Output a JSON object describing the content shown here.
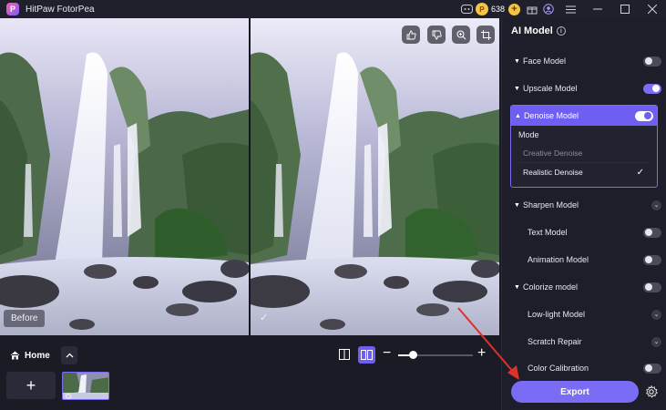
{
  "window": {
    "app_title": "HitPaw FotorPea",
    "logo_letter": "P",
    "credits": "638"
  },
  "canvas": {
    "before_label": "Before",
    "after_check": "✓"
  },
  "bottom": {
    "home_label": "Home",
    "add_symbol": "+",
    "zoom_level": 0.2
  },
  "panel": {
    "title": "AI Model",
    "info_glyph": "i",
    "models": [
      {
        "label": "Face Model",
        "state": "off"
      },
      {
        "label": "Upscale Model",
        "state": "on"
      },
      {
        "label": "Denoise Model",
        "state": "on"
      },
      {
        "label": "Sharpen Model",
        "state": "collapsed"
      },
      {
        "label": "Text Model",
        "state": "off"
      },
      {
        "label": "Animation Model",
        "state": "off"
      },
      {
        "label": "Colorize model",
        "state": "off"
      },
      {
        "label": "Low-light Model",
        "state": "collapsed"
      },
      {
        "label": "Scratch Repair",
        "state": "collapsed"
      },
      {
        "label": "Color Calibration",
        "state": "off"
      }
    ],
    "denoise": {
      "mode_label": "Mode",
      "options": [
        "Creative Denoise",
        "Realistic Denoise"
      ],
      "selected": "Realistic Denoise"
    },
    "export_label": "Export"
  },
  "colors": {
    "accent": "#7b6cf6",
    "panel_bg": "#1e1e2a",
    "arrow": "#e0302a"
  }
}
